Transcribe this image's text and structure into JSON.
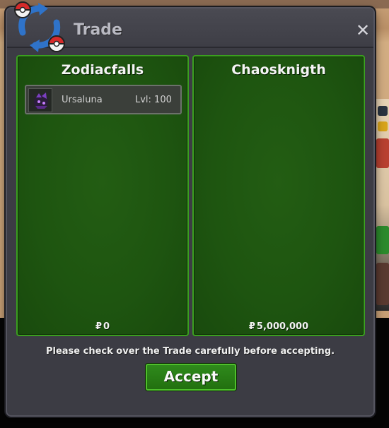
{
  "window": {
    "title": "Trade",
    "close_glyph": "✕",
    "icon": "trade-swap-icon"
  },
  "trade": {
    "left": {
      "player": "Zodiacfalls",
      "items": [
        {
          "name": "Ursaluna",
          "level": "Lvl: 100",
          "icon": "pokemon-sprite-icon"
        }
      ],
      "currency_symbol": "₽",
      "amount": "0"
    },
    "right": {
      "player": "Chaosknigth",
      "items": [],
      "currency_symbol": "₽",
      "amount": "5,000,000"
    }
  },
  "notice": "Please check over the Trade carefully before accepting.",
  "accept_label": "Accept",
  "colors": {
    "panel_green": "#1e5510",
    "panel_border": "#3ba01f",
    "window_bg": "#3c3c44",
    "accept_green": "#2f8a1c"
  }
}
